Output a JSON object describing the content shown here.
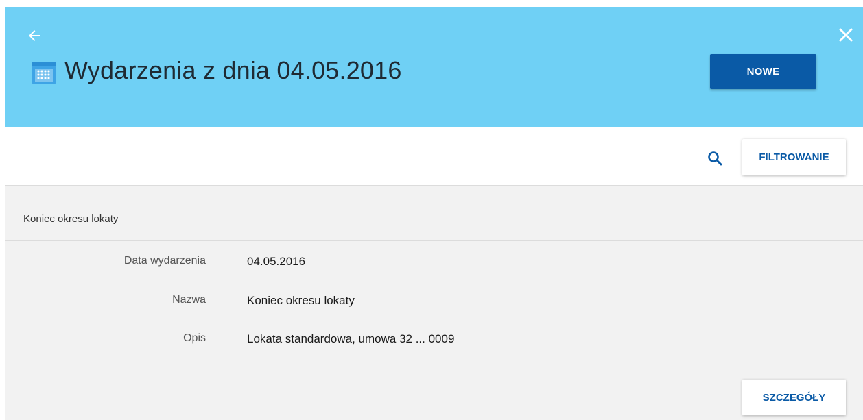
{
  "header": {
    "title": "Wydarzenia z dnia 04.05.2016",
    "new_button_label": "NOWE",
    "background_color": "#6fd0f5",
    "icons": {
      "back": "arrow-left-icon",
      "close": "close-icon",
      "calendar": "calendar-icon"
    }
  },
  "toolbar": {
    "search_icon": "search-icon",
    "filter_button_label": "FILTROWANIE"
  },
  "event": {
    "section_title": "Koniec okresu lokaty",
    "details": [
      {
        "label": "Data wydarzenia",
        "value": "04.05.2016"
      },
      {
        "label": "Nazwa",
        "value": "Koniec okresu lokaty"
      },
      {
        "label": "Opis",
        "value": "Lokata standardowa, umowa 32 ... 0009"
      }
    ],
    "details_button_label": "SZCZEGÓŁY"
  },
  "colors": {
    "primary": "#0a5aa6",
    "content_background": "#f2f2f2"
  }
}
